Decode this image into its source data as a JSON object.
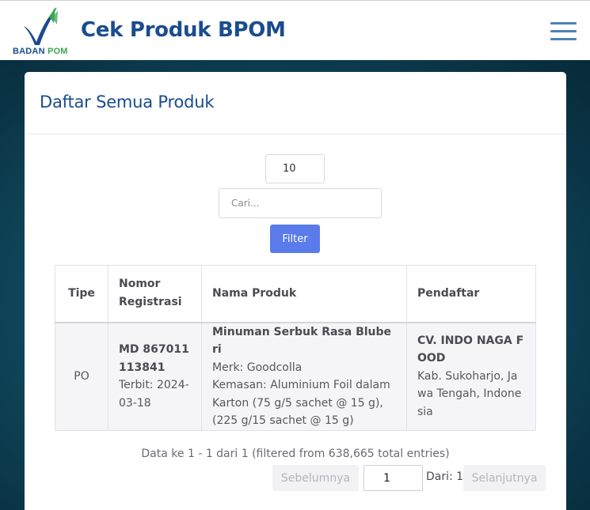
{
  "header": {
    "logo_text_left": "BADAN",
    "logo_text_right": "POM",
    "title": "Cek Produk BPOM",
    "menu_icon": "hamburger-icon"
  },
  "card": {
    "title": "Daftar Semua Produk",
    "page_size": "10",
    "search_placeholder": "Cari...",
    "filter_label": "Filter"
  },
  "table": {
    "headers": {
      "tipe": "Tipe",
      "nomor_1": "Nomor",
      "nomor_2": "Registrasi",
      "nama": "Nama Produk",
      "pendaftar": "Pendaftar"
    },
    "rows": [
      {
        "tipe": "PO",
        "nomor": "MD 867011113841",
        "terbit": "Terbit: 2024-03-18",
        "nama": "Minuman Serbuk Rasa Bluberi",
        "merk": "Merk: Goodcolla",
        "kemasan": "Kemasan: Aluminium Foil dalam Karton (75 g/5 sachet @ 15 g), (225 g/15 sachet @ 15 g)",
        "pendaftar_nama": "CV. INDO NAGA FOOD",
        "pendaftar_alamat": "Kab. Sukoharjo, Jawa Tengah, Indonesia"
      }
    ]
  },
  "footer": {
    "info": "Data ke 1 - 1 dari 1 (filtered from 638,665 total entries)",
    "prev_label": "Sebelumnya",
    "page_value": "1",
    "dari_label": "Dari: 1",
    "next_label": "Selanjutnya"
  },
  "colors": {
    "brand_blue": "#1a4c8f",
    "accent_green": "#3aa84f",
    "button_blue": "#5b7bea",
    "background_teal": "#124e63"
  }
}
